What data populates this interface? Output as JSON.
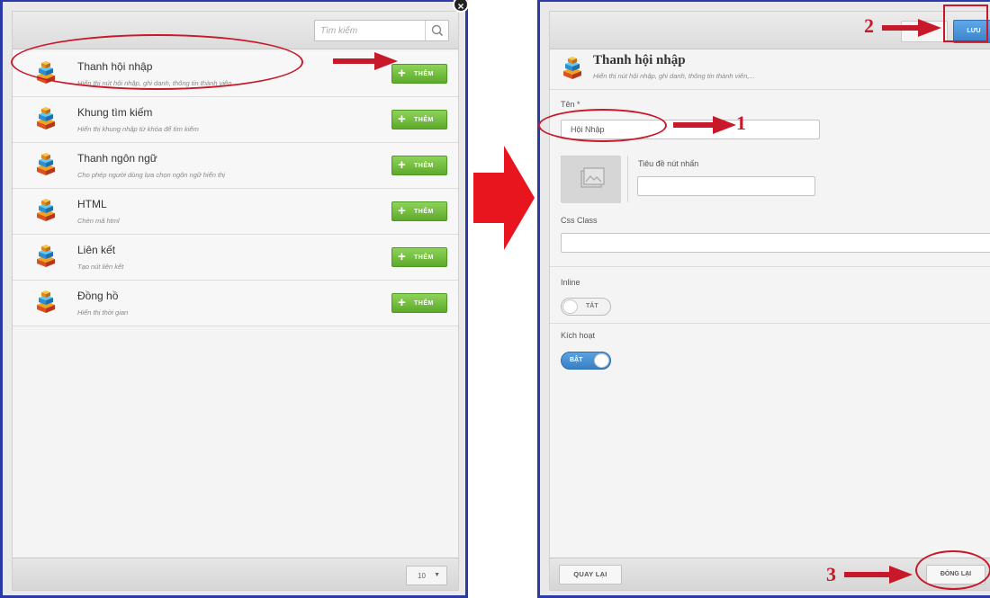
{
  "left": {
    "search": {
      "placeholder": "Tìm kiếm"
    },
    "add_label": "THÊM",
    "widgets": [
      {
        "title": "Thanh hội nhập",
        "description": "Hiển thị nút hội nhập, ghi danh, thông tin thành viên"
      },
      {
        "title": "Khung tìm kiếm",
        "description": "Hiển thị khung nhập từ khóa để tìm kiếm"
      },
      {
        "title": "Thanh ngôn ngữ",
        "description": "Cho phép người dùng lựa chọn ngôn ngữ hiển thị"
      },
      {
        "title": "HTML",
        "description": "Chèn mã html"
      },
      {
        "title": "Liên kết",
        "description": "Tạo nút liên kết"
      },
      {
        "title": "Đồng hồ",
        "description": "Hiển thị thời gian"
      }
    ],
    "page_size": "10",
    "close_glyph": "×"
  },
  "right": {
    "save_label": "LƯU",
    "header": {
      "title": "Thanh hội nhập",
      "description": "Hiển thị nút hội nhập, ghi danh, thông tin thành viên,..."
    },
    "name": {
      "label": "Tên *",
      "value": "Hội Nhập"
    },
    "button_title_label": "Tiêu đề nút nhấn",
    "css_class_label": "Css Class",
    "inline": {
      "label": "Inline",
      "state_text": "TẮT",
      "on": false
    },
    "active": {
      "label": "Kích hoạt",
      "state_text": "BẬT",
      "on": true
    },
    "back_label": "QUAY LẠI",
    "close_label": "ĐÓNG LẠI"
  },
  "annotations": {
    "step1": "1",
    "step2": "2",
    "step3": "3"
  },
  "colors": {
    "annotation_red": "#c8192a",
    "panel_border": "#2c3aa8",
    "add_green": "#6ab93a",
    "save_blue": "#3a83c9"
  }
}
